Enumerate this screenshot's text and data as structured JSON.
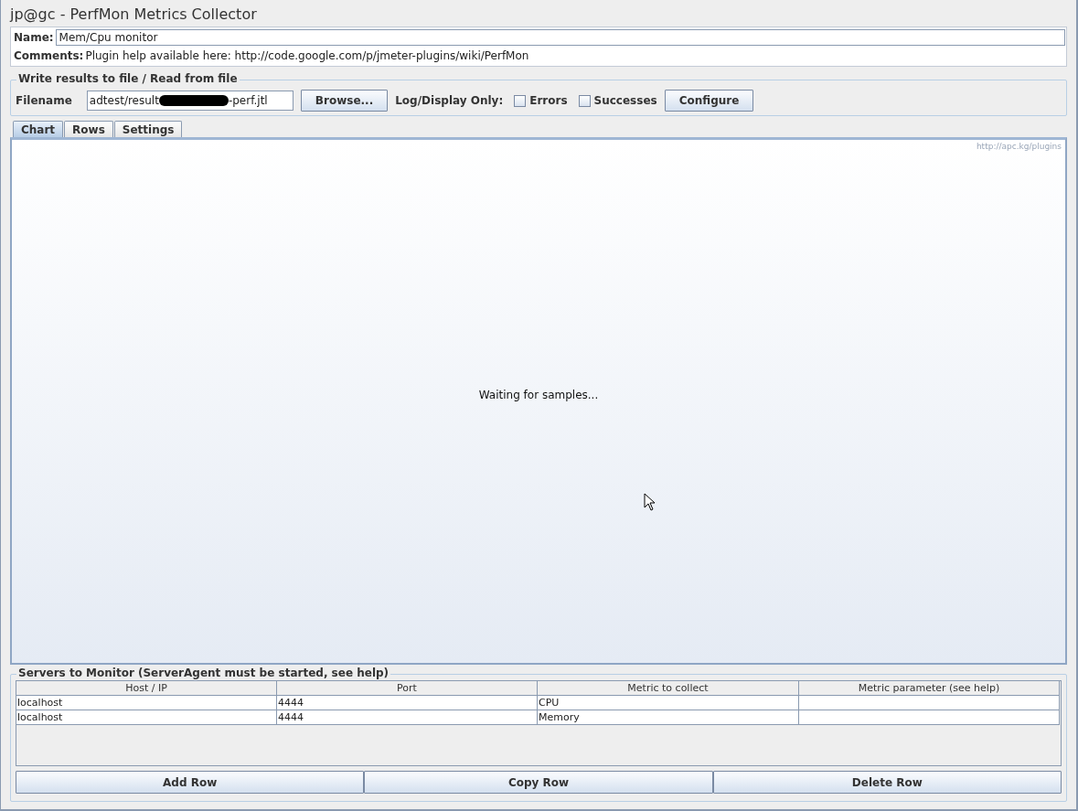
{
  "window": {
    "title": "jp@gc - PerfMon Metrics Collector"
  },
  "name_field": {
    "label": "Name:",
    "value": "Mem/Cpu monitor"
  },
  "comments": {
    "label": "Comments:",
    "value": "Plugin help available here: http://code.google.com/p/jmeter-plugins/wiki/PerfMon"
  },
  "file_group": {
    "title": "Write results to file / Read from file",
    "filename_label": "Filename",
    "value_start": "adtest/result",
    "value_end": "-perf.jtl",
    "redacted": true,
    "browse_button": "Browse...",
    "log_label": "Log/Display Only:",
    "checkboxes": [
      {
        "label": "Errors",
        "checked": false
      },
      {
        "label": "Successes",
        "checked": false
      }
    ],
    "configure_button": "Configure"
  },
  "tabs": [
    {
      "label": "Chart",
      "selected": true
    },
    {
      "label": "Rows",
      "selected": false
    },
    {
      "label": "Settings",
      "selected": false
    }
  ],
  "chart": {
    "watermark": "http://apc.kg/plugins",
    "message": "Waiting for samples..."
  },
  "servers": {
    "title": "Servers to Monitor (ServerAgent must be started, see help)",
    "columns": [
      "Host / IP",
      "Port",
      "Metric to collect",
      "Metric parameter (see help)"
    ],
    "rows": [
      [
        "localhost",
        "4444",
        "CPU",
        ""
      ],
      [
        "localhost",
        "4444",
        "Memory",
        ""
      ]
    ],
    "buttons": [
      "Add Row",
      "Copy Row",
      "Delete Row"
    ]
  }
}
